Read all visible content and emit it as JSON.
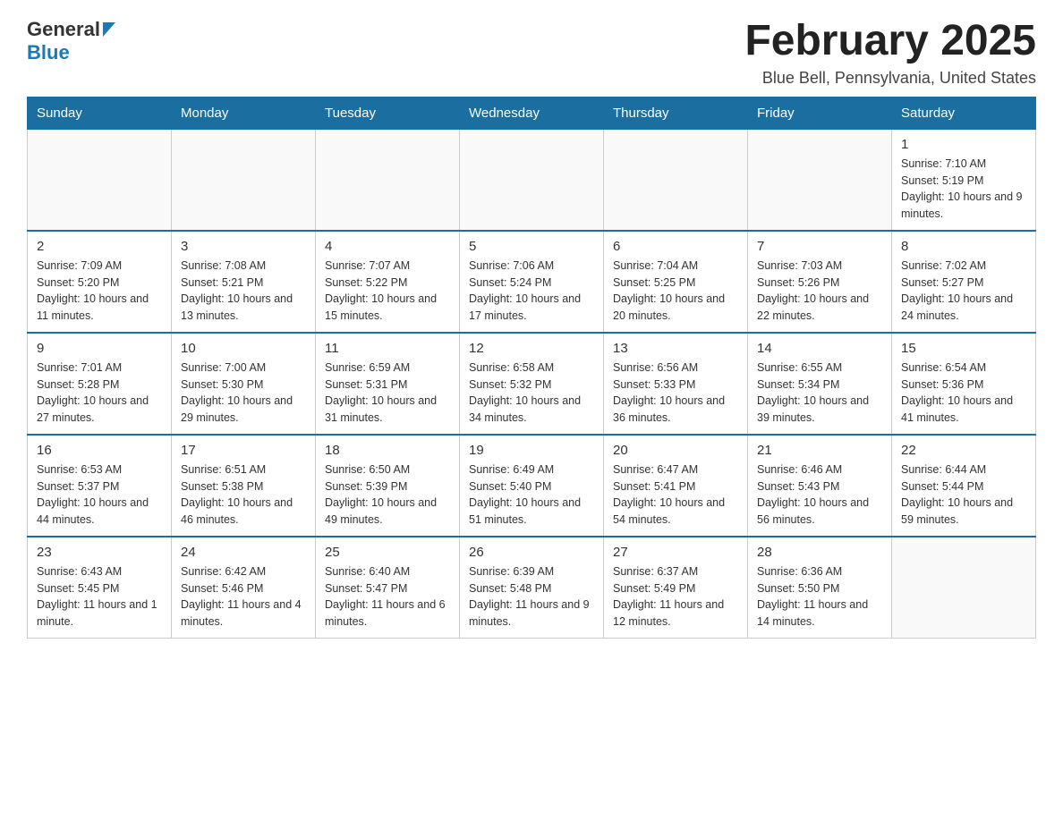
{
  "header": {
    "logo_general": "General",
    "logo_blue": "Blue",
    "month_title": "February 2025",
    "location": "Blue Bell, Pennsylvania, United States"
  },
  "weekdays": [
    "Sunday",
    "Monday",
    "Tuesday",
    "Wednesday",
    "Thursday",
    "Friday",
    "Saturday"
  ],
  "weeks": [
    [
      {
        "day": "",
        "info": ""
      },
      {
        "day": "",
        "info": ""
      },
      {
        "day": "",
        "info": ""
      },
      {
        "day": "",
        "info": ""
      },
      {
        "day": "",
        "info": ""
      },
      {
        "day": "",
        "info": ""
      },
      {
        "day": "1",
        "info": "Sunrise: 7:10 AM\nSunset: 5:19 PM\nDaylight: 10 hours and 9 minutes."
      }
    ],
    [
      {
        "day": "2",
        "info": "Sunrise: 7:09 AM\nSunset: 5:20 PM\nDaylight: 10 hours and 11 minutes."
      },
      {
        "day": "3",
        "info": "Sunrise: 7:08 AM\nSunset: 5:21 PM\nDaylight: 10 hours and 13 minutes."
      },
      {
        "day": "4",
        "info": "Sunrise: 7:07 AM\nSunset: 5:22 PM\nDaylight: 10 hours and 15 minutes."
      },
      {
        "day": "5",
        "info": "Sunrise: 7:06 AM\nSunset: 5:24 PM\nDaylight: 10 hours and 17 minutes."
      },
      {
        "day": "6",
        "info": "Sunrise: 7:04 AM\nSunset: 5:25 PM\nDaylight: 10 hours and 20 minutes."
      },
      {
        "day": "7",
        "info": "Sunrise: 7:03 AM\nSunset: 5:26 PM\nDaylight: 10 hours and 22 minutes."
      },
      {
        "day": "8",
        "info": "Sunrise: 7:02 AM\nSunset: 5:27 PM\nDaylight: 10 hours and 24 minutes."
      }
    ],
    [
      {
        "day": "9",
        "info": "Sunrise: 7:01 AM\nSunset: 5:28 PM\nDaylight: 10 hours and 27 minutes."
      },
      {
        "day": "10",
        "info": "Sunrise: 7:00 AM\nSunset: 5:30 PM\nDaylight: 10 hours and 29 minutes."
      },
      {
        "day": "11",
        "info": "Sunrise: 6:59 AM\nSunset: 5:31 PM\nDaylight: 10 hours and 31 minutes."
      },
      {
        "day": "12",
        "info": "Sunrise: 6:58 AM\nSunset: 5:32 PM\nDaylight: 10 hours and 34 minutes."
      },
      {
        "day": "13",
        "info": "Sunrise: 6:56 AM\nSunset: 5:33 PM\nDaylight: 10 hours and 36 minutes."
      },
      {
        "day": "14",
        "info": "Sunrise: 6:55 AM\nSunset: 5:34 PM\nDaylight: 10 hours and 39 minutes."
      },
      {
        "day": "15",
        "info": "Sunrise: 6:54 AM\nSunset: 5:36 PM\nDaylight: 10 hours and 41 minutes."
      }
    ],
    [
      {
        "day": "16",
        "info": "Sunrise: 6:53 AM\nSunset: 5:37 PM\nDaylight: 10 hours and 44 minutes."
      },
      {
        "day": "17",
        "info": "Sunrise: 6:51 AM\nSunset: 5:38 PM\nDaylight: 10 hours and 46 minutes."
      },
      {
        "day": "18",
        "info": "Sunrise: 6:50 AM\nSunset: 5:39 PM\nDaylight: 10 hours and 49 minutes."
      },
      {
        "day": "19",
        "info": "Sunrise: 6:49 AM\nSunset: 5:40 PM\nDaylight: 10 hours and 51 minutes."
      },
      {
        "day": "20",
        "info": "Sunrise: 6:47 AM\nSunset: 5:41 PM\nDaylight: 10 hours and 54 minutes."
      },
      {
        "day": "21",
        "info": "Sunrise: 6:46 AM\nSunset: 5:43 PM\nDaylight: 10 hours and 56 minutes."
      },
      {
        "day": "22",
        "info": "Sunrise: 6:44 AM\nSunset: 5:44 PM\nDaylight: 10 hours and 59 minutes."
      }
    ],
    [
      {
        "day": "23",
        "info": "Sunrise: 6:43 AM\nSunset: 5:45 PM\nDaylight: 11 hours and 1 minute."
      },
      {
        "day": "24",
        "info": "Sunrise: 6:42 AM\nSunset: 5:46 PM\nDaylight: 11 hours and 4 minutes."
      },
      {
        "day": "25",
        "info": "Sunrise: 6:40 AM\nSunset: 5:47 PM\nDaylight: 11 hours and 6 minutes."
      },
      {
        "day": "26",
        "info": "Sunrise: 6:39 AM\nSunset: 5:48 PM\nDaylight: 11 hours and 9 minutes."
      },
      {
        "day": "27",
        "info": "Sunrise: 6:37 AM\nSunset: 5:49 PM\nDaylight: 11 hours and 12 minutes."
      },
      {
        "day": "28",
        "info": "Sunrise: 6:36 AM\nSunset: 5:50 PM\nDaylight: 11 hours and 14 minutes."
      },
      {
        "day": "",
        "info": ""
      }
    ]
  ]
}
